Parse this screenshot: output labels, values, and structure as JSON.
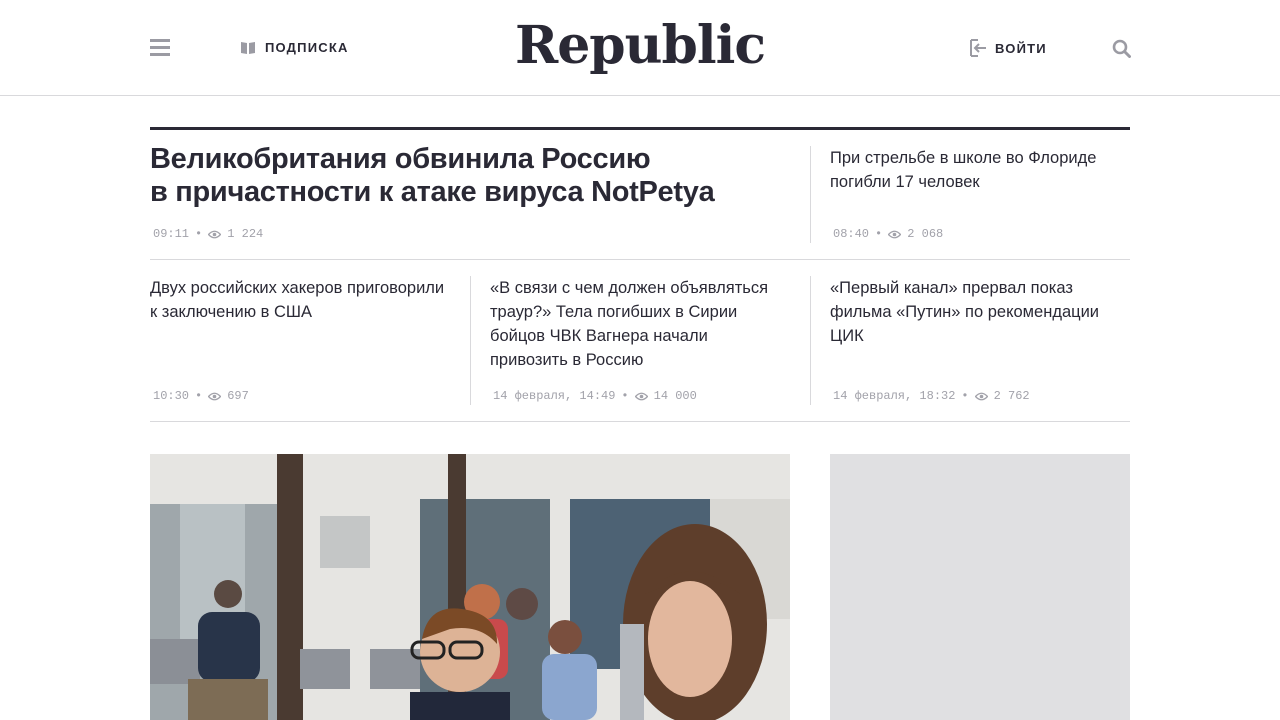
{
  "header": {
    "menu_icon": "hamburger-icon",
    "subscribe_label": "ПОДПИСКА",
    "subscribe_icon": "book-icon",
    "logo": "Republic",
    "login_label": "ВОЙТИ",
    "login_icon": "login-icon",
    "search_icon": "search-icon"
  },
  "lead": {
    "title_line1": "Великобритания обвинила Россию",
    "title_line2": "в причастности к атаке вируса NotPetya",
    "time": "09:11",
    "views": "1 224"
  },
  "side_news": {
    "title": "При стрельбе в школе во Флориде погибли 17 человек",
    "time": "08:40",
    "views": "2 068"
  },
  "row_news": [
    {
      "title": "Двух российских хакеров приговорили к заключению в США",
      "time": "10:30",
      "views": "697"
    },
    {
      "title": "«В связи с чем должен объявляться траур?» Тела погибших в Сирии бойцов ЧВК Вагнера начали привозить в Россию",
      "time": "14 февраля, 14:49",
      "views": "14 000"
    },
    {
      "title": "«Первый канал» прервал показ фильма «Путин» по рекомендации ЦИК",
      "time": "14 февраля, 18:32",
      "views": "2 762"
    }
  ],
  "colors": {
    "text": "#2a2935",
    "meta": "#a2a2aa",
    "rule": "#d9d9dc",
    "ad_bg": "#e0e0e2"
  }
}
